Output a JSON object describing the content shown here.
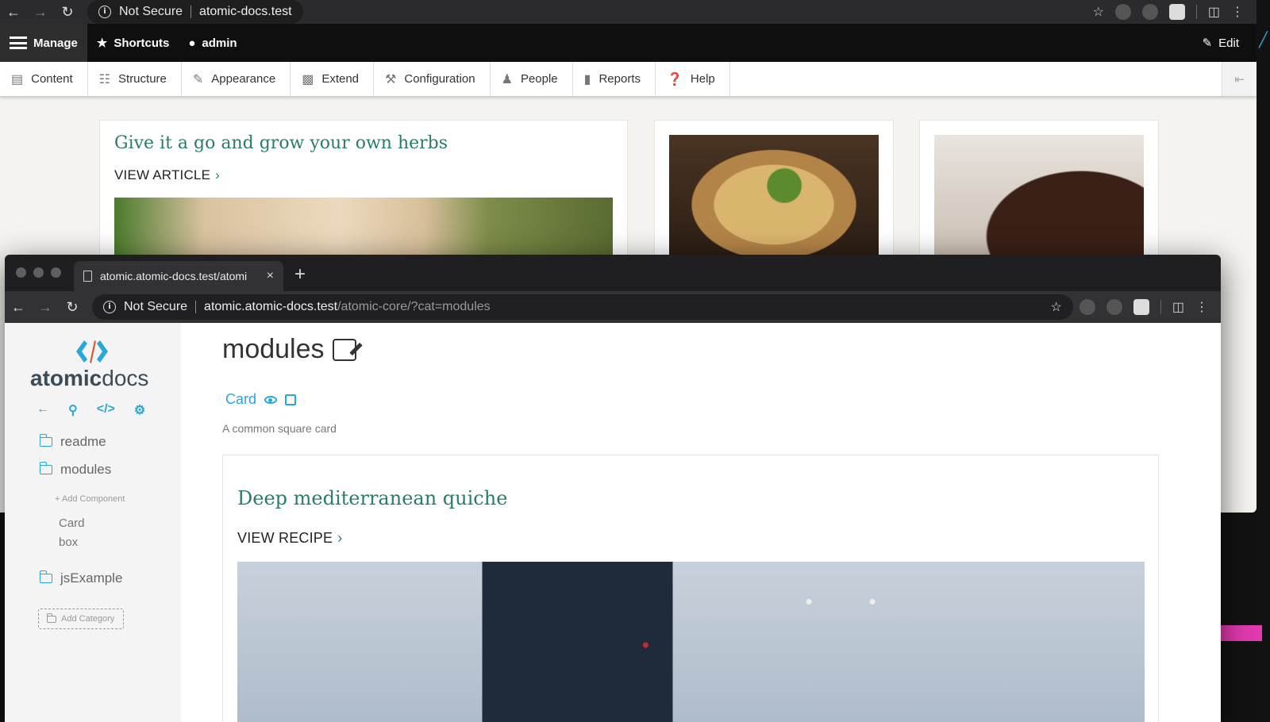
{
  "back_window": {
    "toolbar": {
      "security_label": "Not Secure",
      "url_host": "atomic-docs.test"
    },
    "admin_bar": {
      "manage": "Manage",
      "shortcuts": "Shortcuts",
      "user": "admin",
      "edit": "Edit"
    },
    "tray": [
      {
        "label": "Content",
        "icon": "file-icon"
      },
      {
        "label": "Structure",
        "icon": "sitemap-icon"
      },
      {
        "label": "Appearance",
        "icon": "paintbrush-icon"
      },
      {
        "label": "Extend",
        "icon": "puzzle-icon"
      },
      {
        "label": "Configuration",
        "icon": "wrench-icon"
      },
      {
        "label": "People",
        "icon": "people-icon"
      },
      {
        "label": "Reports",
        "icon": "bar-chart-icon"
      },
      {
        "label": "Help",
        "icon": "help-icon"
      }
    ],
    "article": {
      "title": "Give it a go and grow your own herbs",
      "link": "VIEW ARTICLE"
    }
  },
  "front_window": {
    "tab_title": "atomic.atomic-docs.test/atomi",
    "toolbar": {
      "security_label": "Not Secure",
      "url_host": "atomic.atomic-docs.test",
      "url_path": "/atomic-core/?cat=modules"
    },
    "logo": {
      "bold": "atomic",
      "light": "docs"
    },
    "sidebar": {
      "categories": [
        "readme",
        "modules",
        "jsExample"
      ],
      "add_component": "Add Component",
      "components": [
        "Card",
        "box"
      ],
      "add_category": "Add Category"
    },
    "main": {
      "title": "modules",
      "component_name": "Card",
      "component_desc": "A common square card",
      "preview_title": "Deep mediterranean quiche",
      "preview_link": "VIEW RECIPE"
    }
  },
  "colors": {
    "accent_green": "#2a7d63",
    "accent_blue": "#2aa6d8",
    "admin_bar": "#0f0f0f"
  }
}
